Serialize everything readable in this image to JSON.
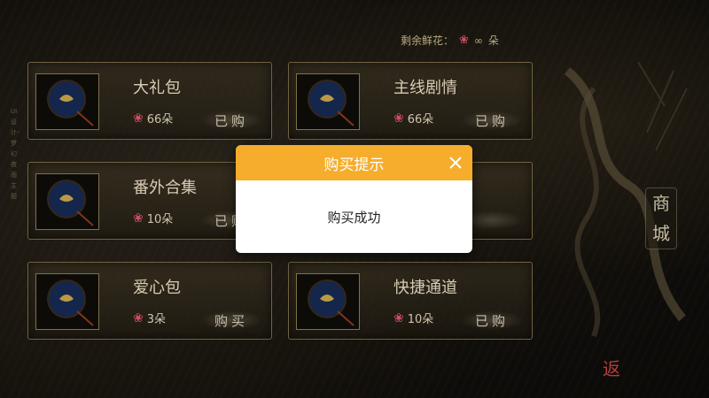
{
  "header": {
    "flowers_label": "剩余鲜花：",
    "flowers_value": "∞",
    "flowers_unit": "朵"
  },
  "side_text": "UI设计-梦幻 夜雨主题",
  "items": [
    {
      "title": "大礼包",
      "price": "66朵",
      "button": "已购"
    },
    {
      "title": "主线剧情",
      "price": "66朵",
      "button": "已购"
    },
    {
      "title": "番外合集",
      "price": "10朵",
      "button": "已购"
    },
    {
      "title": "",
      "price": "",
      "button": ""
    },
    {
      "title": "爱心包",
      "price": "3朵",
      "button": "购买"
    },
    {
      "title": "快捷通道",
      "price": "10朵",
      "button": "已购"
    }
  ],
  "shop_label": [
    "商",
    "城"
  ],
  "back_label": "返",
  "dialog": {
    "title": "购买提示",
    "message": "购买成功"
  },
  "colors": {
    "dialog_header": "#f6ad2b",
    "rose": "#e0556b",
    "back": "#c94040"
  },
  "icons": {
    "item_thumbnail": "fan-icon",
    "price": "rose-icon",
    "close": "close-icon"
  }
}
